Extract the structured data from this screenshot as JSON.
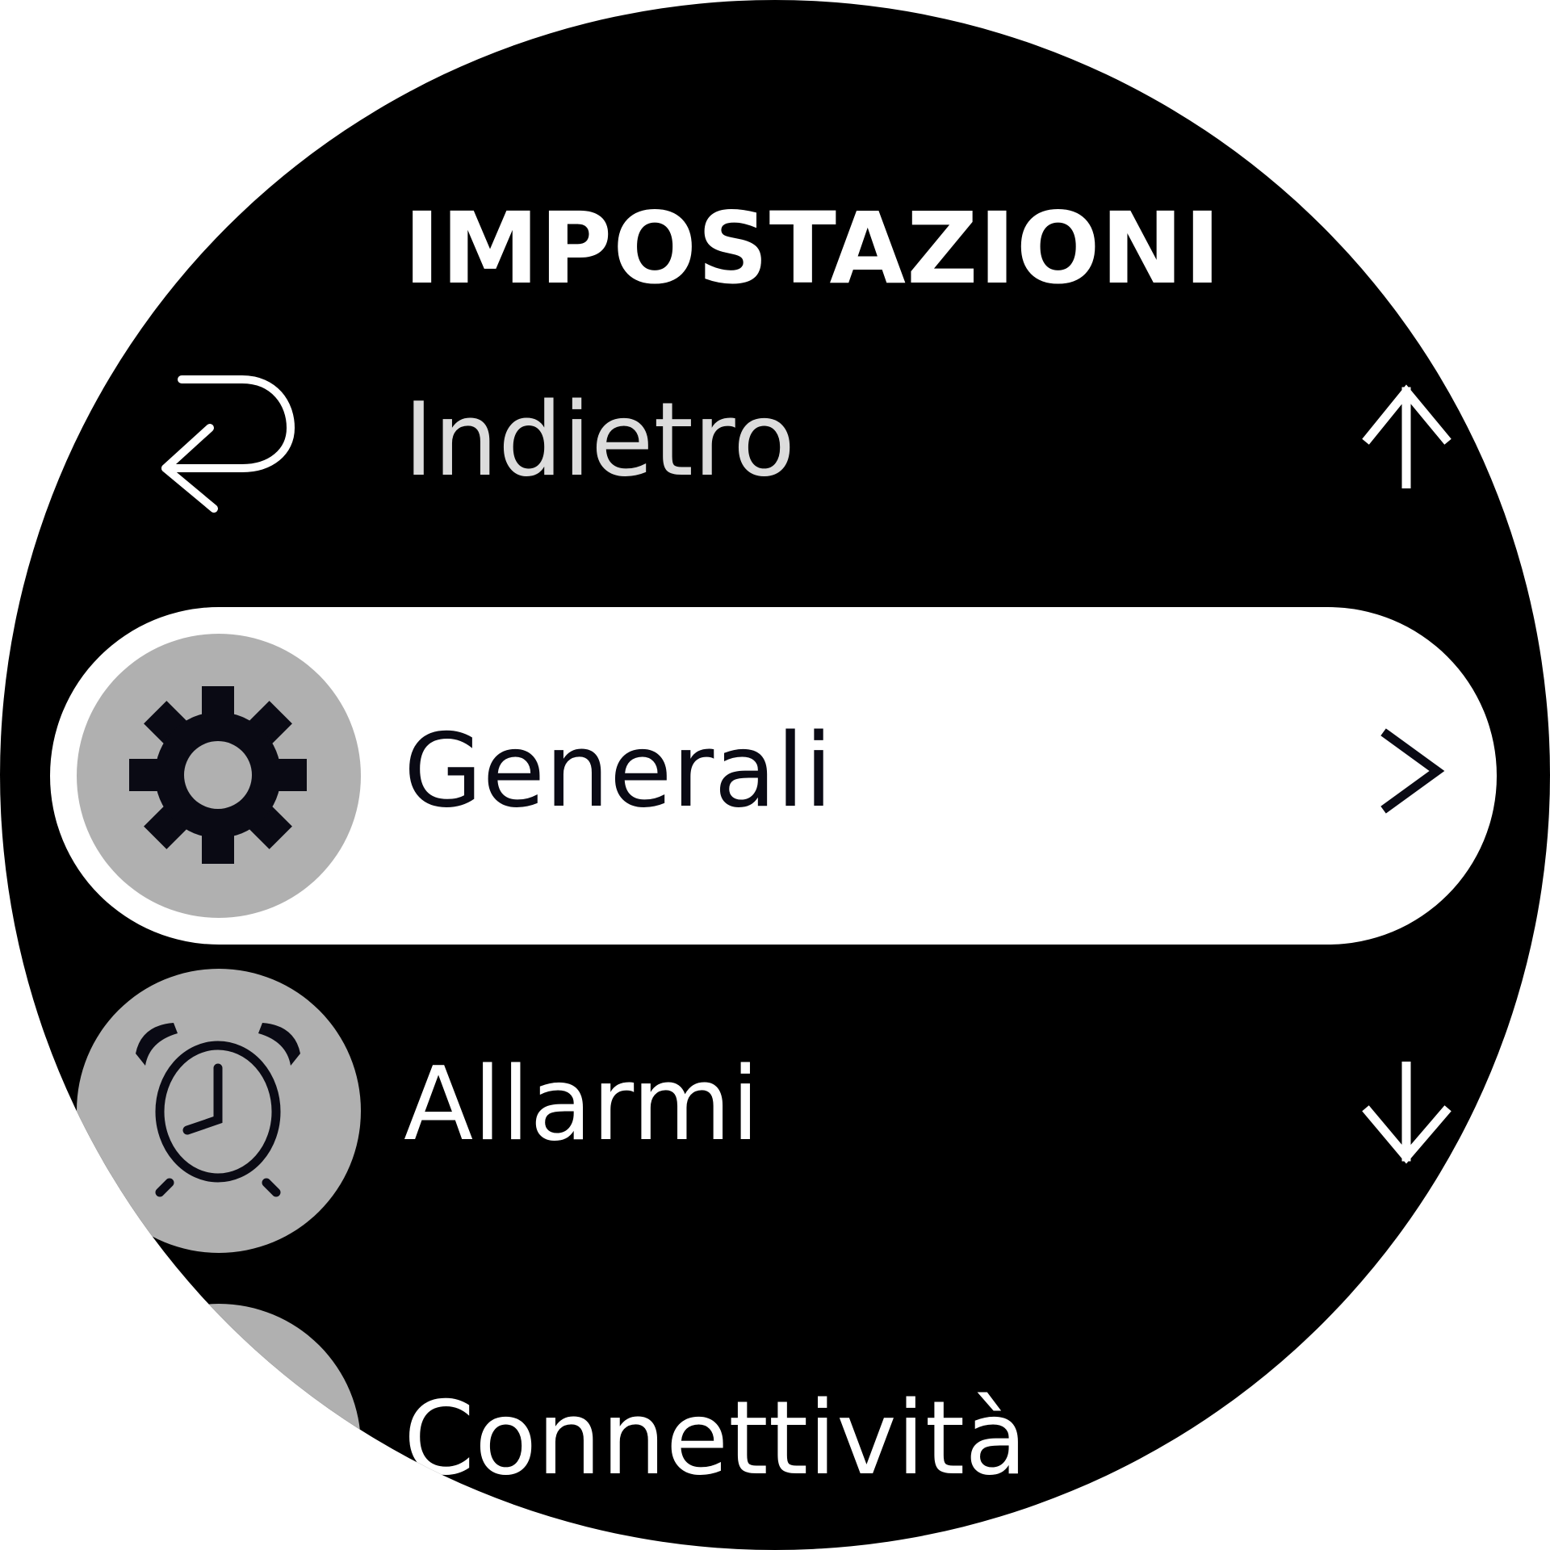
{
  "header": {
    "title": "IMPOSTAZIONI"
  },
  "menu": {
    "items": [
      {
        "label": "Indietro",
        "icon": "back-return-icon",
        "hint_icon": "arrow-up-icon"
      },
      {
        "label": "Generali",
        "icon": "gear-icon",
        "hint_icon": "chevron-right-icon",
        "selected": true
      },
      {
        "label": "Allarmi",
        "icon": "alarm-clock-icon",
        "hint_icon": "arrow-down-icon"
      },
      {
        "label": "Connettività",
        "icon": "connectivity-icon"
      }
    ]
  },
  "colors": {
    "background": "#000000",
    "text": "#ffffff",
    "selected_row": "#ffffff",
    "selected_text": "#0a0a14",
    "icon_circle": "#b0b0b0"
  }
}
